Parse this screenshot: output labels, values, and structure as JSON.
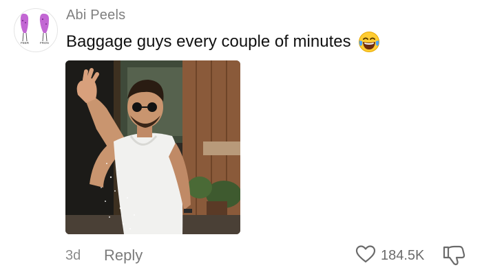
{
  "comment": {
    "author": "Abi Peels",
    "text": "Baggage guys every couple of minutes",
    "emoji": "laughing-with-tears-emoji",
    "avatar_caption_left": "FEER",
    "avatar_caption_right": "FRON",
    "age": "3d",
    "reply_label": "Reply",
    "like_count": "184.5K"
  },
  "icons": {
    "like": "heart-outline-icon",
    "dislike": "thumbs-down-outline-icon"
  },
  "colors": {
    "author": "#7f7f7f",
    "text": "#111111",
    "meta": "#8a8a8a",
    "avatar_figure": "#c267d3"
  }
}
